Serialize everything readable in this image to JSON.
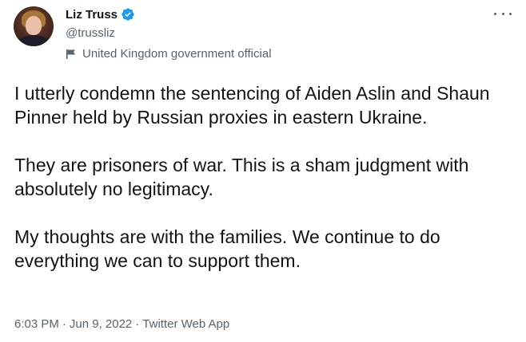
{
  "author": {
    "display_name": "Liz Truss",
    "handle": "@trussliz",
    "account_label": "United Kingdom government official"
  },
  "tweet": {
    "paragraphs": [
      "I utterly condemn the sentencing of Aiden Aslin and Shaun Pinner held by Russian proxies in eastern Ukraine.",
      "They are prisoners of war. This is a sham judgment with absolutely no legitimacy.",
      "My thoughts are with the families. We continue to do everything we can to support them."
    ],
    "time": "6:03 PM",
    "separator": "·",
    "date": "Jun 9, 2022",
    "source": "Twitter Web App"
  },
  "icons": {
    "verified": "verified-badge-icon",
    "label": "flag-icon",
    "more": "more-icon"
  },
  "colors": {
    "verified": "#1d9bf0",
    "text": "#0f1419",
    "secondary": "#536471"
  }
}
